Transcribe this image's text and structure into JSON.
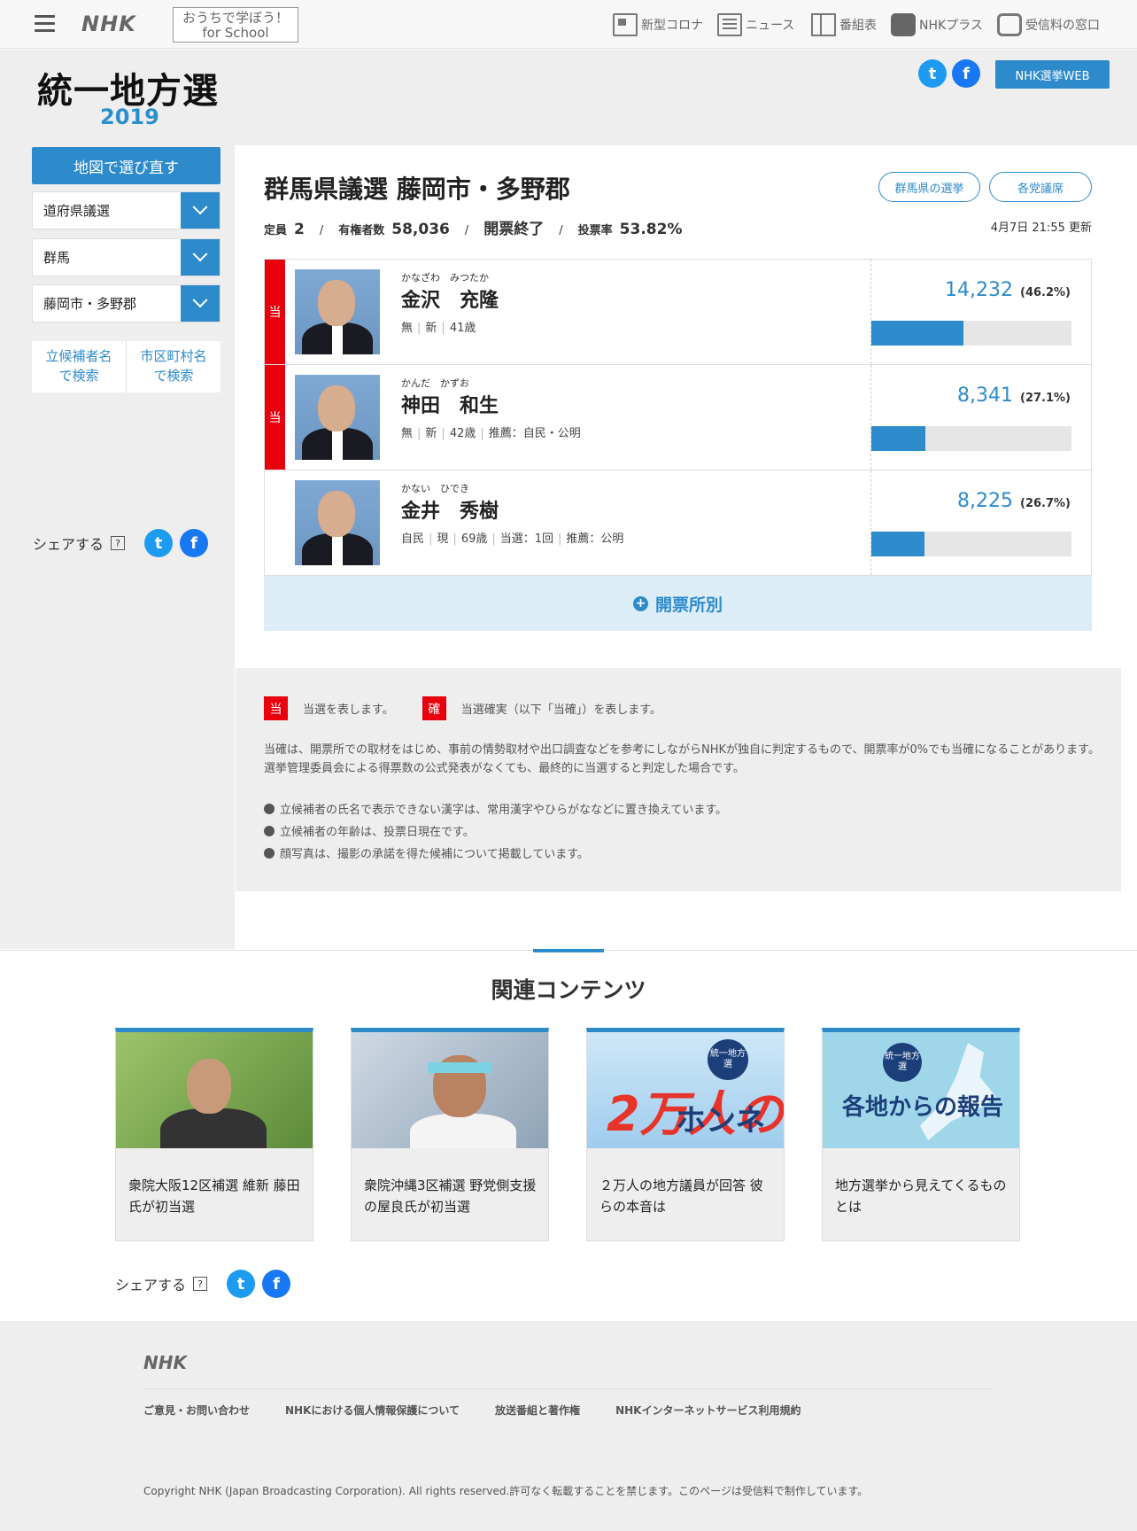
{
  "global_header": {
    "logo": "NHK",
    "school_line1": "おうちで学ぼう！",
    "school_line2": "for School",
    "nav": [
      {
        "label": "新型コロナ",
        "icon": "covid-info-icon"
      },
      {
        "label": "ニュース",
        "icon": "news-icon"
      },
      {
        "label": "番組表",
        "icon": "program-guide-icon"
      },
      {
        "label": "NHKプラス",
        "icon": "nhk-plus-icon"
      },
      {
        "label": "受信料の窓口",
        "icon": "reception-fee-icon"
      }
    ]
  },
  "site": {
    "title": "統一地方選",
    "year": "2019",
    "web_button": "NHK選挙WEB"
  },
  "sidebar": {
    "map_button": "地図で選び直す",
    "selects": [
      "道府県議選",
      "群馬",
      "藤岡市・多野郡"
    ],
    "search_candidate_l1": "立候補者名",
    "search_candidate_l2": "で検索",
    "search_city_l1": "市区町村名",
    "search_city_l2": "で検索",
    "share_label": "シェアする",
    "help_mark": "?"
  },
  "race": {
    "title": "群馬県議選 藤岡市・多野郡",
    "link_prefecture": "群馬県の選挙",
    "link_parties": "各党議席",
    "seats_label": "定員",
    "seats": "2",
    "voters_label": "有権者数",
    "voters": "58,036",
    "status": "開票終了",
    "turnout_label": "投票率",
    "turnout": "53.82%",
    "updated": "4月7日 21:55 更新",
    "booth_button": "開票所別"
  },
  "candidates": [
    {
      "elected": true,
      "mark": "当",
      "kana": "かなざわ　みつたか",
      "name": "金沢　充隆",
      "meta": [
        "無",
        "新",
        "41歳"
      ],
      "votes": "14,232",
      "pct_label": "(46.2%)",
      "pct": 46.2
    },
    {
      "elected": true,
      "mark": "当",
      "kana": "かんだ　かずお",
      "name": "神田　和生",
      "meta": [
        "無",
        "新",
        "42歳",
        "推薦：自民・公明"
      ],
      "votes": "8,341",
      "pct_label": "(27.1%)",
      "pct": 27.1
    },
    {
      "elected": false,
      "mark": "",
      "kana": "かない　ひでき",
      "name": "金井　秀樹",
      "meta": [
        "自民",
        "現",
        "69歳",
        "当選：1回",
        "推薦：公明"
      ],
      "votes": "8,225",
      "pct_label": "(26.7%)",
      "pct": 26.7
    }
  ],
  "notes": {
    "mark_win": "当",
    "mark_win_text": "当選を表します。",
    "mark_sure": "確",
    "mark_sure_text": "当選確実（以下「当確」）を表します。",
    "para": "当確は、開票所での取材をはじめ、事前の情勢取材や出口調査などを参考にしながらNHKが独自に判定するもので、開票率が0%でも当確になることがあります。選挙管理委員会による得票数の公式発表がなくても、最終的に当選すると判定した場合です。",
    "items": [
      "立候補者の氏名で表示できない漢字は、常用漢字やひらがななどに置き換えています。",
      "立候補者の年齢は、投票日現在です。",
      "顔写真は、撮影の承諾を得た候補について掲載しています。"
    ]
  },
  "related": {
    "title": "関連コンテンツ",
    "cards": [
      {
        "caption": "衆院大阪12区補選 維新 藤田氏が初当選"
      },
      {
        "caption": "衆院沖縄3区補選 野党側支援の屋良氏が初当選"
      },
      {
        "caption": "２万人の地方議員が回答 彼らの本音は",
        "thumb_big": "2万人の",
        "thumb_sub": "ホンネ",
        "thumb_badge": "統一地方選"
      },
      {
        "caption": "地方選挙から見えてくるものとは",
        "thumb_text": "各地からの報告",
        "thumb_badge": "統一地方選"
      }
    ],
    "share_label": "シェアする",
    "help_mark": "?"
  },
  "footer": {
    "logo": "NHK",
    "links": [
      "ご意見・お問い合わせ",
      "NHKにおける個人情報保護について",
      "放送番組と著作権",
      "NHKインターネットサービス利用規約"
    ],
    "copyright": "Copyright NHK (Japan Broadcasting Corporation). All rights reserved.許可なく転載することを禁じます。このページは受信料で制作しています。"
  },
  "colors": {
    "accent": "#2e8bcb",
    "elected": "#e8000d",
    "panel": "#eeeeee"
  }
}
